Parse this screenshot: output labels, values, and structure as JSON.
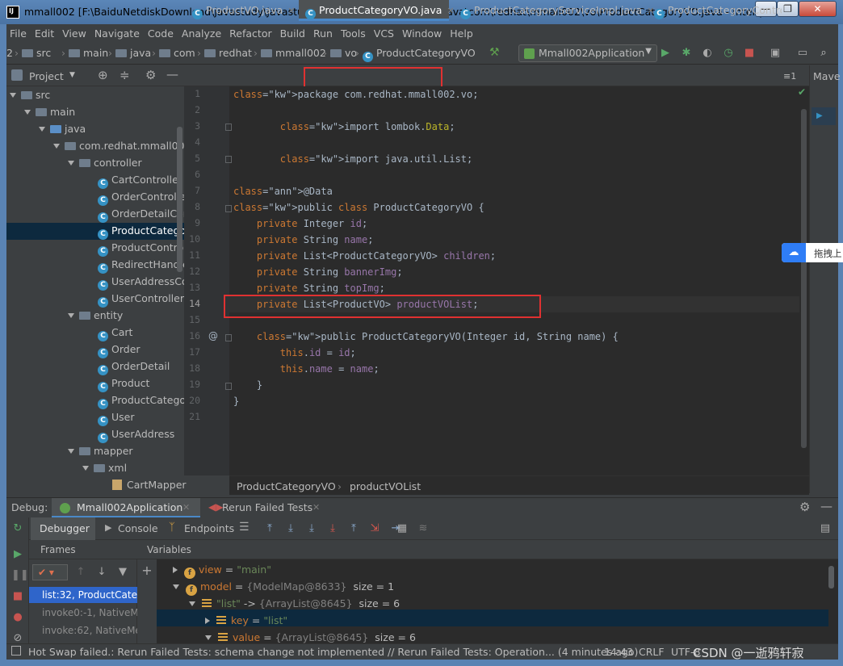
{
  "window": {
    "title": "mmall002 [F:\\BaiduNetdiskDownload\\javastudy\\javastudy\\mmall002] - ...\\src\\main\\java\\com\\redhat\\mmall002\\vo\\ProductCategoryVO.java - IntelliJ IDEA (A",
    "minimize": "—",
    "maximize": "❐",
    "close": "✕"
  },
  "menu": [
    "File",
    "Edit",
    "View",
    "Navigate",
    "Code",
    "Analyze",
    "Refactor",
    "Build",
    "Run",
    "Tools",
    "VCS",
    "Window",
    "Help"
  ],
  "navbar": {
    "crumbs": [
      "2",
      "src",
      "main",
      "java",
      "com",
      "redhat",
      "mmall002",
      "vo",
      "ProductCategoryVO"
    ],
    "run_config": "Mmall002Application"
  },
  "project": {
    "header": "Project",
    "tree": [
      {
        "label": "src",
        "type": "folder",
        "open": true
      },
      {
        "label": "main",
        "type": "folder",
        "open": true
      },
      {
        "label": "java",
        "type": "folder",
        "open": true
      },
      {
        "label": "com.redhat.mmall002",
        "type": "folder",
        "open": true
      },
      {
        "label": "controller",
        "type": "folder",
        "open": true
      },
      {
        "label": "CartController",
        "type": "class"
      },
      {
        "label": "OrderController",
        "type": "class"
      },
      {
        "label": "OrderDetailCon",
        "type": "class"
      },
      {
        "label": "ProductCatego",
        "type": "class"
      },
      {
        "label": "ProductControl",
        "type": "class"
      },
      {
        "label": "RedirectHandle",
        "type": "class"
      },
      {
        "label": "UserAddressCo",
        "type": "class"
      },
      {
        "label": "UserController",
        "type": "class"
      },
      {
        "label": "entity",
        "type": "folder",
        "open": true
      },
      {
        "label": "Cart",
        "type": "class"
      },
      {
        "label": "Order",
        "type": "class"
      },
      {
        "label": "OrderDetail",
        "type": "class"
      },
      {
        "label": "Product",
        "type": "class"
      },
      {
        "label": "ProductCatego",
        "type": "class"
      },
      {
        "label": "User",
        "type": "class"
      },
      {
        "label": "UserAddress",
        "type": "class"
      },
      {
        "label": "mapper",
        "type": "folder",
        "open": true
      },
      {
        "label": "xml",
        "type": "folder",
        "open": true
      },
      {
        "label": "CartMapper",
        "type": "file"
      }
    ]
  },
  "tabs": [
    {
      "label": "ProductVO.java",
      "active": false
    },
    {
      "label": "ProductCategoryVO.java",
      "active": true
    },
    {
      "label": "ProductCategoryServiceImpl.java",
      "active": false
    },
    {
      "label": "ProductCategoryContro",
      "active": false
    }
  ],
  "tabs_more": "≡1",
  "right_strip": "Mave",
  "editor": {
    "line_numbers": [
      "1",
      "2",
      "3",
      "4",
      "5",
      "6",
      "7",
      "8",
      "9",
      "10",
      "11",
      "12",
      "13",
      "14",
      "15",
      "16",
      "17",
      "18",
      "19",
      "20",
      "21"
    ],
    "lines": [
      [
        "package com.redhat.mmall002.vo;"
      ],
      [
        ""
      ],
      [
        "import lombok.Data;"
      ],
      [
        ""
      ],
      [
        "import java.util.List;"
      ],
      [
        ""
      ],
      [
        "@Data"
      ],
      [
        "public class ProductCategoryVO {"
      ],
      [
        "private Integer id;"
      ],
      [
        "private String name;"
      ],
      [
        "private List<ProductCategoryVO> children;"
      ],
      [
        "private String bannerImg;"
      ],
      [
        "private String topImg;"
      ],
      [
        "private List<ProductVO> productVOList;"
      ],
      [
        ""
      ],
      [
        "public ProductCategoryVO(Integer id, String name) {"
      ],
      [
        "this.id = id;"
      ],
      [
        "this.name = name;"
      ],
      [
        "}"
      ],
      [
        "}"
      ],
      [
        ""
      ]
    ],
    "breadcrumbs": [
      "ProductCategoryVO",
      "productVOList"
    ]
  },
  "baidu": {
    "text": "拖拽上"
  },
  "debug": {
    "label": "Debug:",
    "sessions": [
      "Mmall002Application",
      "Rerun Failed Tests"
    ],
    "tabs": [
      "Debugger",
      "Console",
      "Endpoints"
    ],
    "frames_header": "Frames",
    "variables_header": "Variables",
    "frames": [
      "list:32, ProductCateg",
      "invoke0:-1, NativeMe",
      "invoke:62, NativeMe"
    ],
    "variables": [
      {
        "name": "view",
        "eq": " = ",
        "value": "\"main\""
      },
      {
        "name": "model",
        "eq": " = ",
        "value": "{ModelMap@8633}",
        "extra": "size = 1"
      },
      {
        "name": "\"list\"",
        "eq": " -> ",
        "value": "{ArrayList@8645}",
        "extra": "size = 6"
      },
      {
        "name": "key",
        "eq": " = ",
        "value": "\"list\""
      },
      {
        "name": "value",
        "eq": " = ",
        "value": "{ArrayList@8645}",
        "extra": "size = 6"
      }
    ]
  },
  "status": {
    "message": "Hot Swap failed.: Rerun Failed Tests: schema change not implemented // Rerun Failed Tests: Operation... (4 minutes ago)",
    "position": "14:43",
    "line_sep": "CRLF",
    "encoding": "UTF-8",
    "watermark": "CSDN @一逝鸦轩寂"
  }
}
